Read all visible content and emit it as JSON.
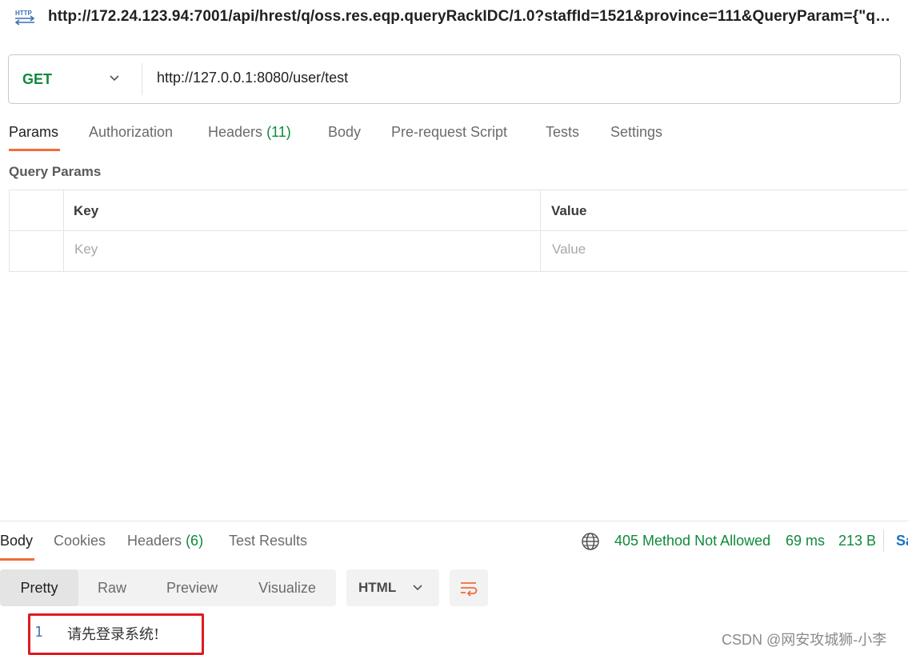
{
  "title_bar": {
    "icon": "http-icon",
    "title": "http://172.24.123.94:7001/api/hrest/q/oss.res.eqp.queryRackIDC/1.0?staffId=1521&province=111&QueryParam={\"query..."
  },
  "request": {
    "method": "GET",
    "url": "http://127.0.0.1:8080/user/test"
  },
  "request_tabs": {
    "params": "Params",
    "authorization": "Authorization",
    "headers": "Headers",
    "headers_count": "(11)",
    "body": "Body",
    "pre_request": "Pre-request Script",
    "tests": "Tests",
    "settings": "Settings"
  },
  "query_params": {
    "label": "Query Params",
    "columns": [
      "Key",
      "Value"
    ],
    "key_placeholder": "Key",
    "value_placeholder": "Value"
  },
  "response_tabs": {
    "body": "Body",
    "cookies": "Cookies",
    "headers": "Headers",
    "headers_count": "(6)",
    "test_results": "Test Results"
  },
  "response_meta": {
    "status": "405 Method Not Allowed",
    "time": "69 ms",
    "size": "213 B",
    "save_partial": "Sa"
  },
  "view_modes": [
    "Pretty",
    "Raw",
    "Preview",
    "Visualize"
  ],
  "format": "HTML",
  "code": {
    "line_number": "1",
    "text": "请先登录系统!"
  },
  "colors": {
    "accent_orange": "#f26b3a",
    "success_green": "#0f8a3a",
    "highlight_red": "#e0191f"
  },
  "watermark": "CSDN @网安攻城狮-小李"
}
